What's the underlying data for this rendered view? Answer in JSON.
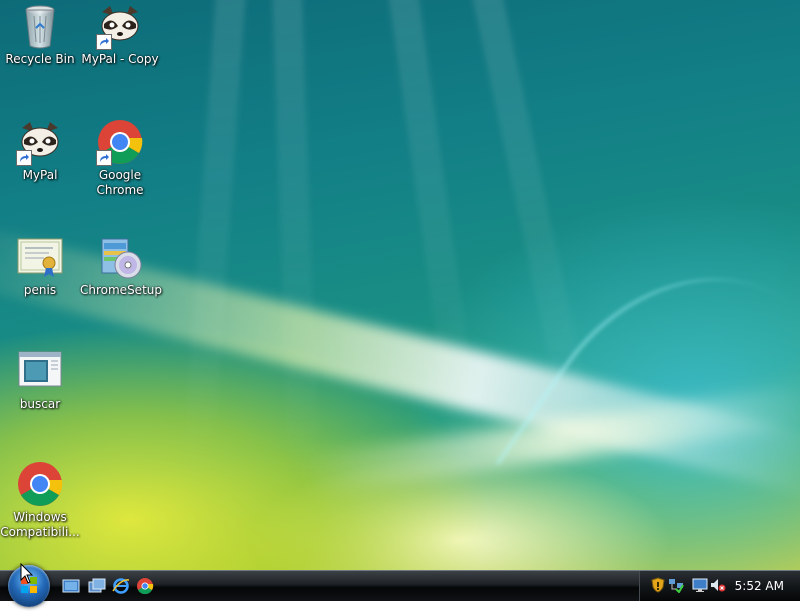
{
  "desktop": {
    "icons": [
      {
        "label": "Recycle Bin",
        "icon": "recycle-bin-icon",
        "shortcut": false
      },
      {
        "label": "MyPal - Copy",
        "icon": "raccoon-icon",
        "shortcut": true
      },
      {
        "label": "MyPal",
        "icon": "raccoon-icon",
        "shortcut": true
      },
      {
        "label": "Google Chrome",
        "icon": "chrome-icon",
        "shortcut": true
      },
      {
        "label": "penis",
        "icon": "certificate-icon",
        "shortcut": false
      },
      {
        "label": "ChromeSetup",
        "icon": "installer-icon",
        "shortcut": false
      },
      {
        "label": "buscar",
        "icon": "window-app-icon",
        "shortcut": false
      },
      {
        "label": "Windows Compatibili...",
        "icon": "chrome-icon",
        "shortcut": false
      }
    ]
  },
  "taskbar": {
    "start_button": "start-orb-icon",
    "quick_launch": [
      "show-desktop-icon",
      "switch-windows-icon",
      "internet-explorer-icon",
      "chrome-icon"
    ],
    "tray_icons": [
      "security-shield-icon",
      "network-icon",
      "display-icon",
      "volume-muted-icon"
    ],
    "clock": "5:52 AM"
  },
  "colors": {
    "taskbar": "#101215",
    "accent_blue": "#2369b8",
    "chrome_red": "#db4437",
    "chrome_yellow": "#f4c20d",
    "chrome_green": "#0f9d58",
    "chrome_blue": "#4285f4"
  }
}
